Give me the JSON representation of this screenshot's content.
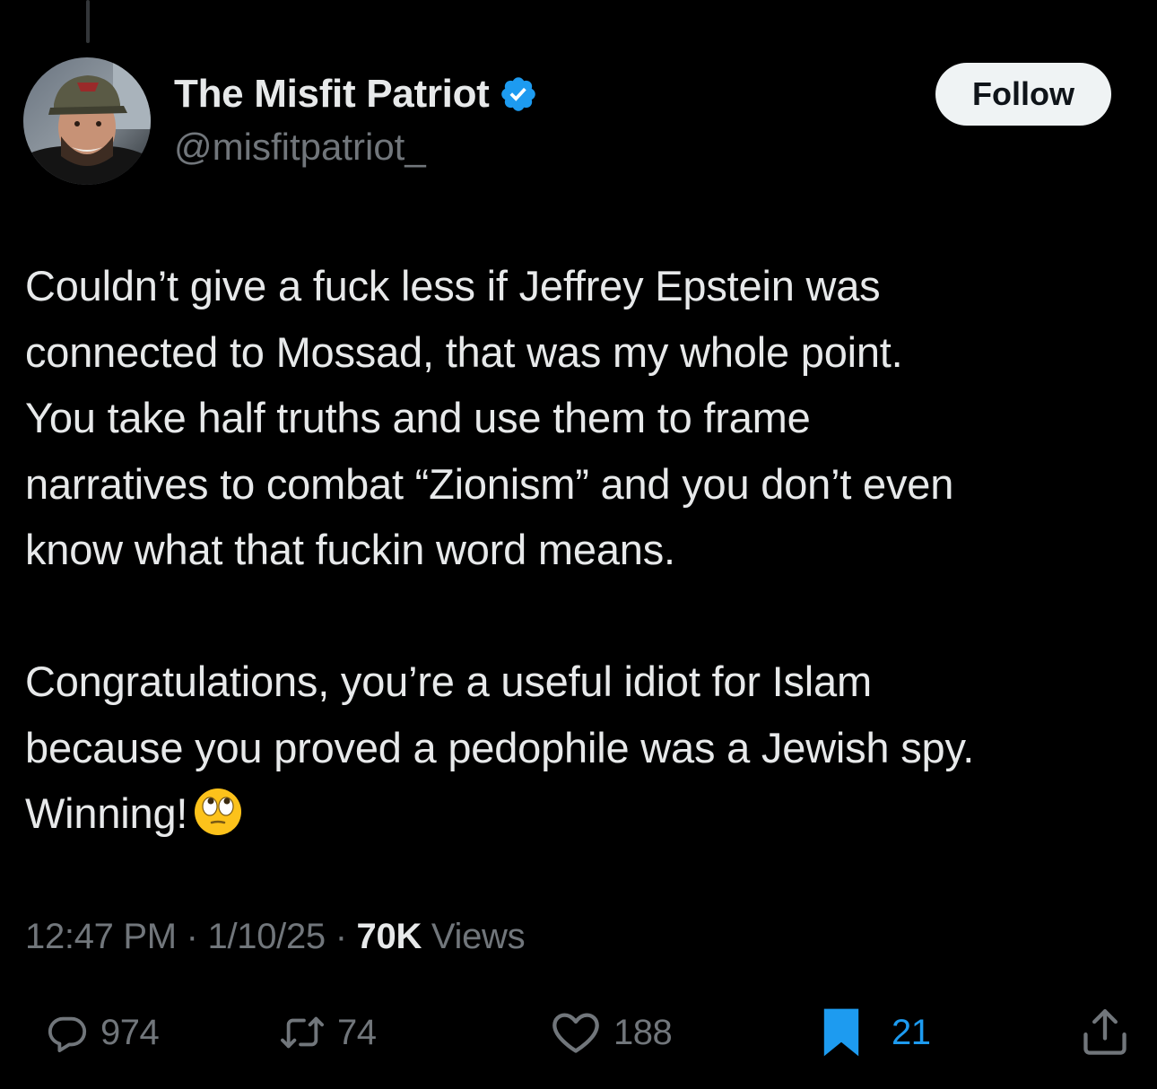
{
  "tweet": {
    "author": {
      "display_name": "The Misfit Patriot",
      "handle": "@misfitpatriot_",
      "verified": true
    },
    "follow_label": "Follow",
    "body_lines_p1": [
      "Couldn’t give a fuck less if Jeffrey Epstein was",
      "connected to Mossad, that was my whole point.",
      "You take half truths and use them to frame",
      "narratives to combat “Zionism” and you don’t even",
      "know what that fuckin word means."
    ],
    "body_lines_p2": [
      "Congratulations, you’re a useful idiot for Islam",
      "because you proved a pedophile was a Jewish spy.",
      "Winning!"
    ],
    "emoji": "face-with-rolling-eyes",
    "time": "12:47 PM",
    "separator": "·",
    "date": "1/10/25",
    "views_count": "70K",
    "views_label": "Views",
    "stats": {
      "replies": "974",
      "reposts": "74",
      "likes": "188",
      "bookmarks": "21"
    }
  },
  "colors": {
    "background": "#000000",
    "text_primary": "#e7e9ea",
    "text_secondary": "#71767b",
    "accent_blue": "#1d9bf0",
    "follow_bg": "#eff3f4"
  },
  "icons": {
    "verified": "verified-badge-icon",
    "reply": "reply-icon",
    "repost": "repost-icon",
    "like": "heart-icon",
    "bookmark": "bookmark-icon",
    "share": "share-icon"
  }
}
